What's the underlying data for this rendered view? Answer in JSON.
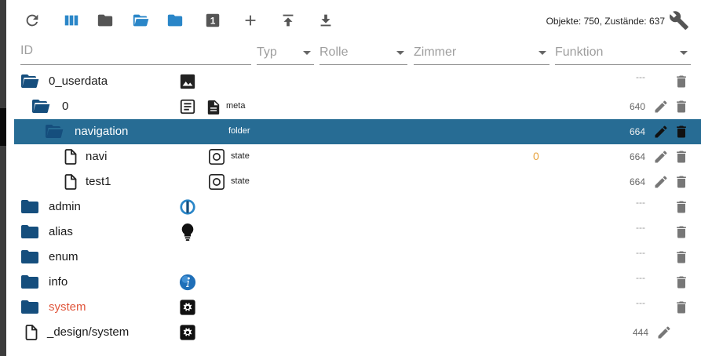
{
  "toolbar": {
    "buttons": [
      {
        "name": "refresh",
        "icon": "refresh-icon"
      },
      {
        "name": "columns",
        "icon": "columns-icon"
      },
      {
        "name": "collapse",
        "icon": "folder-icon"
      },
      {
        "name": "expand-all",
        "icon": "folder-open-icon"
      },
      {
        "name": "expand",
        "icon": "folder-icon"
      },
      {
        "name": "expert-level",
        "icon": "number-box-icon",
        "label": "1"
      },
      {
        "name": "add",
        "icon": "plus-icon"
      },
      {
        "name": "upload",
        "icon": "upload-icon"
      },
      {
        "name": "download",
        "icon": "download-icon"
      }
    ],
    "counts": "Objekte: 750, Zustände: 637",
    "settings_icon": "wrench-icon"
  },
  "filters": {
    "id_placeholder": "ID",
    "type_label": "Typ",
    "role_label": "Rolle",
    "room_label": "Zimmer",
    "function_label": "Funktion"
  },
  "colors": {
    "folder": "#154e7d",
    "folder_light": "#2a86c8",
    "selected_row": "#276c94",
    "value": "#e8a33d",
    "system_text": "#e0563c"
  },
  "rows": [
    {
      "name": "0_userdata",
      "level": 0,
      "icon": "folder-open-icon",
      "type_icon": "image-icon",
      "acl": "---",
      "delete": true
    },
    {
      "name": "0",
      "level": 1,
      "icon": "folder-open-icon",
      "type_icon": "document-lines-icon",
      "type_icon2": "file-text-icon",
      "type_label": "meta",
      "acl": "640",
      "edit": true,
      "delete": true
    },
    {
      "name": "navigation",
      "level": 2,
      "icon": "folder-open-icon",
      "type_label": "folder",
      "acl": "664",
      "edit": true,
      "delete": true,
      "selected": true
    },
    {
      "name": "navi",
      "level": 3,
      "icon": "file-outline-icon",
      "type_icon": "state-circle-icon",
      "type_label": "state",
      "value": "0",
      "acl": "664",
      "edit": true,
      "delete": true
    },
    {
      "name": "test1",
      "level": 3,
      "icon": "file-outline-icon",
      "type_icon": "state-circle-icon",
      "type_label": "state",
      "acl": "664",
      "edit": true,
      "delete": true
    },
    {
      "name": "admin",
      "level": 0,
      "icon": "folder-icon",
      "type_icon": "admin-logo-icon",
      "acl": "---",
      "delete": true
    },
    {
      "name": "alias",
      "level": 0,
      "icon": "folder-icon",
      "type_icon": "lightbulb-icon",
      "acl": "---",
      "delete": true
    },
    {
      "name": "enum",
      "level": 0,
      "icon": "folder-icon",
      "acl": "---",
      "delete": true
    },
    {
      "name": "info",
      "level": 0,
      "icon": "folder-icon",
      "type_icon": "info-globe-icon",
      "acl": "---",
      "delete": true
    },
    {
      "name": "system",
      "level": 0,
      "icon": "folder-icon",
      "type_icon": "gear-box-icon",
      "acl": "---",
      "delete": true
    },
    {
      "name": "_design/system",
      "level": 0,
      "icon": "file-outline-icon",
      "type_icon": "gear-box-icon",
      "acl": "444",
      "edit": true
    }
  ]
}
